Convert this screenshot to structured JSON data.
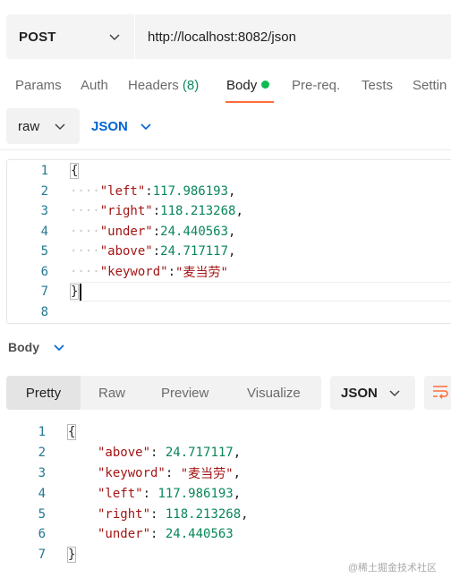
{
  "request": {
    "method": "POST",
    "url": "http://localhost:8082/json"
  },
  "tabs": {
    "params": "Params",
    "auth": "Auth",
    "headers": "Headers",
    "headers_count": "(8)",
    "body": "Body",
    "prereq": "Pre-req.",
    "tests": "Tests",
    "settings": "Settin"
  },
  "body_options": {
    "mode": "raw",
    "language": "JSON"
  },
  "editor": {
    "line_numbers": [
      "1",
      "2",
      "3",
      "4",
      "5",
      "6",
      "7",
      "8"
    ],
    "open_brace": "{",
    "close_brace": "}",
    "indent": "····",
    "fields": [
      {
        "key": "\"left\"",
        "value": "117.986193",
        "sep": ","
      },
      {
        "key": "\"right\"",
        "value": "118.213268",
        "sep": ","
      },
      {
        "key": "\"under\"",
        "value": "24.440563",
        "sep": ","
      },
      {
        "key": "\"above\"",
        "value": "24.717117",
        "sep": ","
      },
      {
        "key": "\"keyword\"",
        "value": "\"麦当劳\"",
        "sep": ""
      }
    ]
  },
  "response": {
    "title": "Body",
    "view_tabs": [
      "Pretty",
      "Raw",
      "Preview",
      "Visualize"
    ],
    "format": "JSON",
    "line_numbers": [
      "1",
      "2",
      "3",
      "4",
      "5",
      "6",
      "7"
    ],
    "open_brace": "{",
    "close_brace": "}",
    "fields": [
      {
        "key": "\"above\"",
        "value": "24.717117",
        "sep": ","
      },
      {
        "key": "\"keyword\"",
        "value": "\"麦当劳\"",
        "sep": ","
      },
      {
        "key": "\"left\"",
        "value": "117.986193",
        "sep": ","
      },
      {
        "key": "\"right\"",
        "value": "118.213268",
        "sep": ","
      },
      {
        "key": "\"under\"",
        "value": "24.440563",
        "sep": ""
      }
    ]
  },
  "watermark": "@稀土掘金技术社区",
  "colors": {
    "accent": "#ff6c37",
    "active_dot": "#0cbb52",
    "link_blue": "#0265d2",
    "json_key": "#a31515",
    "json_number": "#098658",
    "line_number": "#237893"
  }
}
